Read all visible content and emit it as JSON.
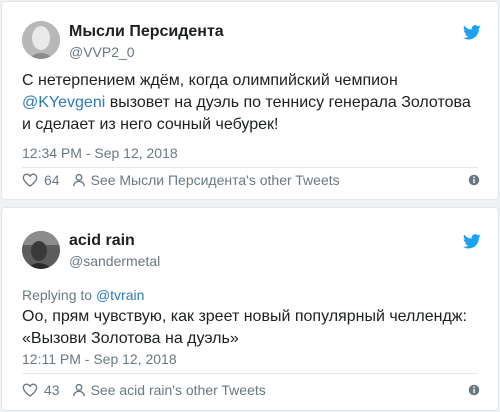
{
  "tweets": [
    {
      "display_name": "Мысли Персидента",
      "handle": "@VVP2_0",
      "text_before": "С нетерпением ждём, когда олимпийский чемпион ",
      "mention": "@KYevgeni",
      "text_after": " вызовет на дуэль по теннису генерала Золотова и сделает из него сочный чебурек!",
      "timestamp": "12:34 PM - Sep 12, 2018",
      "likes": "64",
      "other_tweets_label": "See Мысли Персидента's other Tweets",
      "icons": [
        "avatar",
        "twitter-bird-icon",
        "heart-icon",
        "person-icon",
        "info-icon"
      ]
    },
    {
      "display_name": "acid rain",
      "handle": "@sandermetal",
      "replying_label": "Replying to ",
      "replying_handle": "@tvrain",
      "text": "Оо, прям чувствую, как зреет новый популярный челлендж: «Вызови Золотова на дуэль»",
      "timestamp": "12:11 PM - Sep 12, 2018",
      "likes": "43",
      "other_tweets_label": "See acid rain's other Tweets",
      "icons": [
        "avatar",
        "twitter-bird-icon",
        "heart-icon",
        "person-icon",
        "info-icon"
      ]
    }
  ],
  "colors": {
    "link": "#2b7bb9",
    "secondary_text": "#697882",
    "twitter_blue": "#1da1f2",
    "border": "#e1e8ed"
  }
}
